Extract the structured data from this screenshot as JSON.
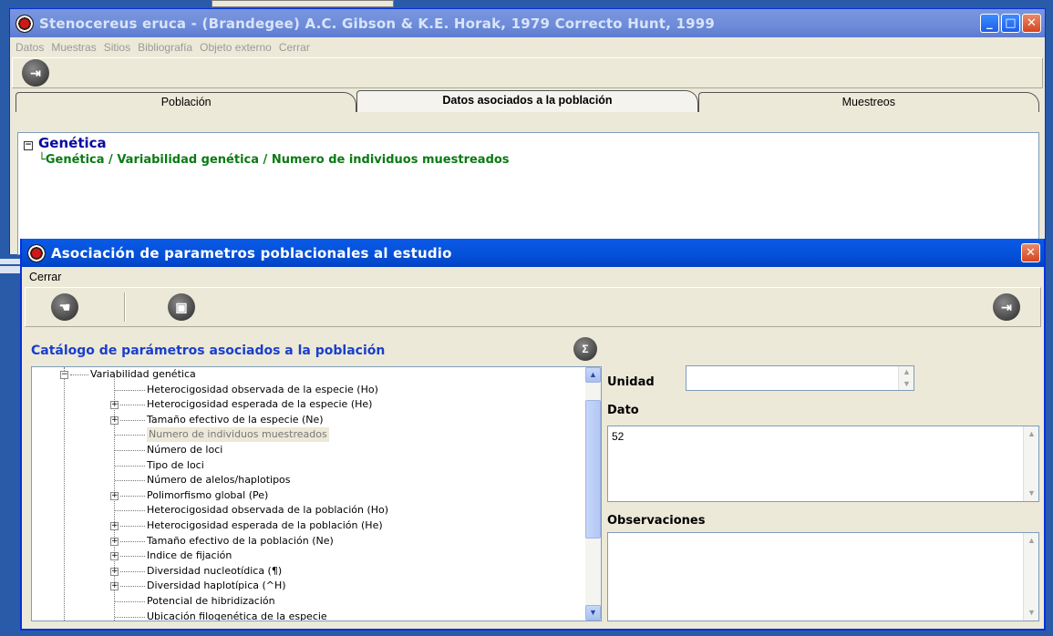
{
  "main_window": {
    "title": "Stenocereus eruca - (Brandegee) A.C. Gibson & K.E. Horak, 1979  Correcto  Hunt, 1999",
    "menu": [
      "Datos",
      "Muestras",
      "Sitios",
      "Bibliografía",
      "Objeto externo",
      "Cerrar"
    ],
    "tabs": [
      "Población",
      "Datos asociados a la población",
      "Muestreos"
    ],
    "active_tab": "Datos asociados a la población",
    "tree": {
      "root": "Genética",
      "child": "Genética / Variabilidad genética / Numero de individuos muestreados"
    }
  },
  "dialog": {
    "title": "Asociación de parametros poblacionales al estudio",
    "menu": [
      "Cerrar"
    ],
    "catalog_title": "Catálogo de parámetros asociados a la población",
    "tree_root": "Variabilidad genética",
    "tree_items": [
      {
        "label": "Heterocigosidad observada de la especie (Ho)",
        "expandable": false
      },
      {
        "label": "Heterocigosidad esperada de la especie (He)",
        "expandable": true
      },
      {
        "label": "Tamaño efectivo de la especie (Ne)",
        "expandable": true
      },
      {
        "label": "Numero de individuos muestreados",
        "expandable": false,
        "selected": true
      },
      {
        "label": "Número de loci",
        "expandable": false
      },
      {
        "label": "Tipo de loci",
        "expandable": false
      },
      {
        "label": "Número de alelos/haplotipos",
        "expandable": false
      },
      {
        "label": "Polimorfismo global (Pe)",
        "expandable": true
      },
      {
        "label": "Heterocigosidad observada de la población (Ho)",
        "expandable": false
      },
      {
        "label": "Heterocigosidad esperada de la población (He)",
        "expandable": true
      },
      {
        "label": "Tamaño efectivo de la población (Ne)",
        "expandable": true
      },
      {
        "label": "Indice de fijación",
        "expandable": true
      },
      {
        "label": "Diversidad nucleotídica (¶)",
        "expandable": true
      },
      {
        "label": "Diversidad haplotípica (^H)",
        "expandable": true
      },
      {
        "label": "Potencial de hibridización",
        "expandable": false
      },
      {
        "label": "Ubicación filogenética de la especie",
        "expandable": false
      }
    ],
    "unidad_label": "Unidad",
    "unidad_value": "",
    "dato_label": "Dato",
    "dato_value": "52",
    "observaciones_label": "Observaciones",
    "observaciones_value": ""
  },
  "colors": {
    "titlebar": "#0450d8",
    "tree_root": "#0a0aa0",
    "tree_child": "#0a7a14",
    "catalog_title": "#1a3ecc"
  }
}
